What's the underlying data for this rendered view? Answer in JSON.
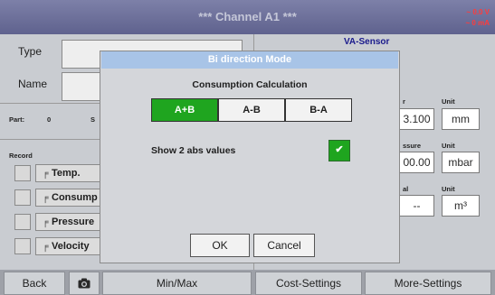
{
  "window": {
    "title": "***   Channel A1   ***",
    "status_voltage": "~ 0.0 V",
    "status_current": "~ 0 mA"
  },
  "background": {
    "type_label": "Type",
    "name_label": "Name",
    "sensor_name": "VA-Sensor",
    "part_label": "Part:",
    "part_value": "0",
    "part_partial": "S",
    "record_label": "Record",
    "record_items": [
      {
        "label": "Temp."
      },
      {
        "label": "Consump"
      },
      {
        "label": "Pressure"
      },
      {
        "label": "Velocity"
      }
    ],
    "diameter": {
      "label_partial": "r",
      "value": "3.100",
      "unit_header": "Unit",
      "unit": "mm"
    },
    "pressure": {
      "label_partial": "ssure",
      "value": "00.00",
      "unit_header": "Unit",
      "unit": "mbar"
    },
    "total": {
      "label_partial": "al",
      "value": "--",
      "unit_header": "Unit",
      "unit": "m³"
    }
  },
  "bottom_bar": {
    "back": "Back",
    "camera_icon": "camera-icon",
    "minmax": "Min/Max",
    "cost": "Cost-Settings",
    "more": "More-Settings"
  },
  "dialog": {
    "title": "Bi direction Mode",
    "heading": "Consumption Calculation",
    "options": [
      "A+B",
      "A-B",
      "B-A"
    ],
    "selected_option": "A+B",
    "show_abs_label": "Show 2 abs values",
    "show_abs_checked": true,
    "check_mark": "✔",
    "ok": "OK",
    "cancel": "Cancel"
  },
  "colors": {
    "accent_green": "#1fa51f",
    "title_bar": "#6a6d98",
    "dialog_title": "#a8c4e7",
    "status_red": "#ff3b3b"
  }
}
